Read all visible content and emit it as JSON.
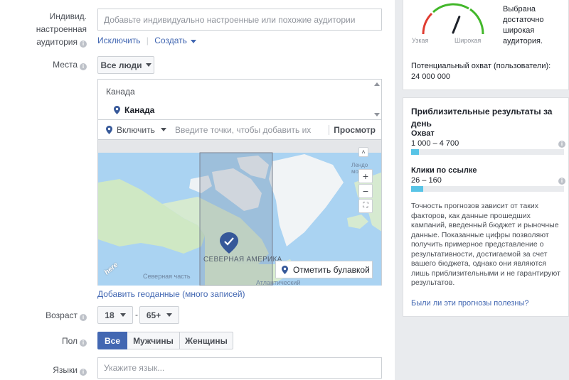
{
  "custom_audience": {
    "label": "Индивид. настроенная аудитория",
    "label_line1": "Индивид. настроенная",
    "label_line2": "аудитория",
    "placeholder": "Добавьте индивидуально настроенные или похожие аудитории",
    "exclude_link": "Исключить",
    "create_link": "Создать"
  },
  "locations": {
    "label": "Места",
    "audience_select": "Все люди",
    "country_header": "Канада",
    "selected_item": "Канада",
    "include_select": "Включить",
    "search_placeholder": "Введите точки, чтобы добавить их",
    "browse_link": "Просмотр",
    "map_region_label": "СЕВЕРНАЯ АМЕРИКА",
    "map_ocean_label": "Северная часть",
    "map_ocean_label2": "Атлантический",
    "map_sea_label": "Лендо море",
    "map_provider": "here",
    "drop_pin_button": "Отметить булавкой",
    "bulk_link": "Добавить геоданные (много записей)"
  },
  "age": {
    "label": "Возраст",
    "min": "18",
    "dash": "-",
    "max": "65+"
  },
  "gender": {
    "label": "Пол",
    "options": [
      "Все",
      "Мужчины",
      "Женщины"
    ],
    "selected": "Все"
  },
  "languages": {
    "label": "Языки",
    "placeholder": "Укажите язык..."
  },
  "audience_size": {
    "gauge_narrow": "Узкая",
    "gauge_wide": "Широкая",
    "description": "Выбрана достаточно широкая аудитория.",
    "desc_line1": "Выбрана",
    "desc_line2": "достаточно",
    "desc_line3": "широкая",
    "desc_line4": "аудитория.",
    "reach_label": "Потенциальный охват (пользователи):",
    "reach_value": "24 000 000",
    "gauge_level": 0.62
  },
  "estimates": {
    "title": "Приблизительные результаты за день",
    "title_line1": "Приблизительные результаты за",
    "title_line2": "день",
    "reach_label": "Охват",
    "reach_range": "1 000 – 4 700",
    "reach_fill": 0.05,
    "clicks_label": "Клики по ссылке",
    "clicks_range": "26 – 160",
    "clicks_fill": 0.08,
    "disclaimer_lines": [
      "Точность прогнозов зависит от таких",
      "факторов, как данные прошедших",
      "кампаний, введенный бюджет и рыночные",
      "данные. Показанные цифры позволяют",
      "получить примерное представление о",
      "результативности, достигаемой за счет",
      "вашего бюджета, однако они являются",
      "лишь приблизительными и не гарантируют",
      "результатов."
    ],
    "feedback_link": "Были ли эти прогнозы полезны?"
  },
  "colors": {
    "accent": "#4267b2",
    "gauge_red": "#e03c31",
    "gauge_yellow": "#f5c33b",
    "gauge_green": "#42b72a",
    "progress": "#58c4e6"
  }
}
